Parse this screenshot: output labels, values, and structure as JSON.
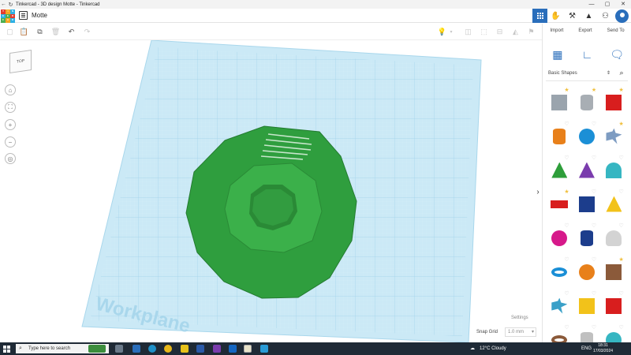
{
  "window": {
    "title": "Tinkercad - 3D design Motte - Tinkercad",
    "controls": [
      "—",
      "▢",
      "✕"
    ]
  },
  "header": {
    "logo_letters": [
      "T",
      "I",
      "N",
      "K",
      "E",
      "R",
      "C",
      "A",
      "D"
    ],
    "design_name": "Motte"
  },
  "right_panel": {
    "actions": {
      "import": "Import",
      "export": "Export",
      "send_to": "Send To"
    },
    "shapes_category": "Basic Shapes",
    "shapes": [
      {
        "name": "box-striped",
        "color": "#9aa4ad",
        "fav": true
      },
      {
        "name": "cylinder-striped",
        "color": "#a8aeb4",
        "fav": true
      },
      {
        "name": "box",
        "color": "#d81e1e",
        "fav": true
      },
      {
        "name": "cylinder",
        "color": "#e8801a",
        "fav": false
      },
      {
        "name": "sphere",
        "color": "#1b8fd6",
        "fav": false
      },
      {
        "name": "scribble",
        "color": "#7e9cc2",
        "fav": true
      },
      {
        "name": "roof",
        "color": "#2e9e3a",
        "fav": false
      },
      {
        "name": "cone",
        "color": "#7a3cad",
        "fav": false
      },
      {
        "name": "round-roof",
        "color": "#36b6c2",
        "fav": false
      },
      {
        "name": "text",
        "color": "#d81e1e",
        "fav": true
      },
      {
        "name": "wedge",
        "color": "#1c3d8c",
        "fav": false
      },
      {
        "name": "pyramid",
        "color": "#f2c21a",
        "fav": false
      },
      {
        "name": "half-sphere",
        "color": "#d6198a",
        "fav": false
      },
      {
        "name": "polygon",
        "color": "#1c3d8c",
        "fav": false
      },
      {
        "name": "paraboloid",
        "color": "#d3d3d3",
        "fav": false
      },
      {
        "name": "torus",
        "color": "#1b8fd6",
        "fav": false
      },
      {
        "name": "tube",
        "color": "#e8801a",
        "fav": false
      },
      {
        "name": "shape-generator",
        "color": "#8b5a3a",
        "fav": true
      },
      {
        "name": "star",
        "color": "#3aa0c8",
        "fav": false
      },
      {
        "name": "heart-ish",
        "color": "#f2c21a",
        "fav": false
      },
      {
        "name": "icosahedron",
        "color": "#d81e1e",
        "fav": false
      },
      {
        "name": "ring",
        "color": "#8b5a3a",
        "fav": false
      },
      {
        "name": "cylinder-grey",
        "color": "#c0c0c0",
        "fav": false
      },
      {
        "name": "ellipsoid",
        "color": "#36b6c2",
        "fav": false
      }
    ]
  },
  "viewport": {
    "view_cube_label": "TOP",
    "workplane_label": "Workplane",
    "model_color": "#2f9e3e",
    "grid_color": "#bfe3f2"
  },
  "snap": {
    "settings_label": "Settings",
    "snap_grid_label": "Snap Grid",
    "snap_grid_value": "1.0 mm"
  },
  "taskbar": {
    "search_placeholder": "Type here to search",
    "weather": "12°C  Cloudy",
    "language": "ENG",
    "time": "18:31",
    "date": "17/03/2024"
  }
}
